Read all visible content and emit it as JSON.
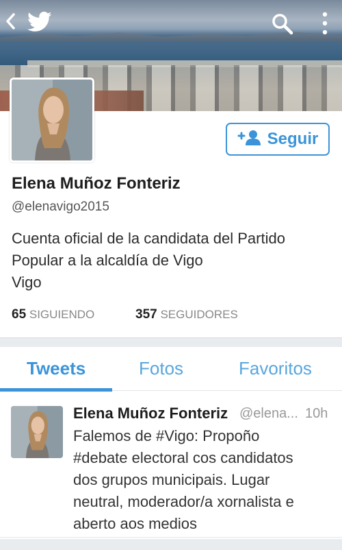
{
  "profile": {
    "name": "Elena Muñoz Fonteriz",
    "handle": "@elenavigo2015",
    "bio_line1": "Cuenta oficial de la candidata del Partido",
    "bio_line2": "Popular a la alcaldía de Vigo",
    "location": "Vigo",
    "following_count": "65",
    "following_label": "SIGUIENDO",
    "followers_count": "357",
    "followers_label": "SEGUIDORES"
  },
  "actions": {
    "follow_label": "Seguir"
  },
  "tabs": [
    {
      "label": "Tweets",
      "active": true
    },
    {
      "label": "Fotos",
      "active": false
    },
    {
      "label": "Favoritos",
      "active": false
    }
  ],
  "tweet": {
    "author": "Elena Muñoz Fonteriz",
    "handle": "@elena...",
    "time": "10h",
    "text_line1": "Falemos de #Vigo: Propoño",
    "text_line2": "#debate electoral cos candidatos",
    "text_line3": "dos grupos municipais. Lugar",
    "text_line4": "neutral, moderador/a xornalista e",
    "text_line5": "aberto aos medios"
  },
  "icons": {
    "back": "chevron-left-icon",
    "brand": "twitter-bird-icon",
    "search": "search-icon",
    "more": "more-vertical-icon",
    "follow": "add-person-icon"
  },
  "colors": {
    "accent": "#3b94d9"
  }
}
